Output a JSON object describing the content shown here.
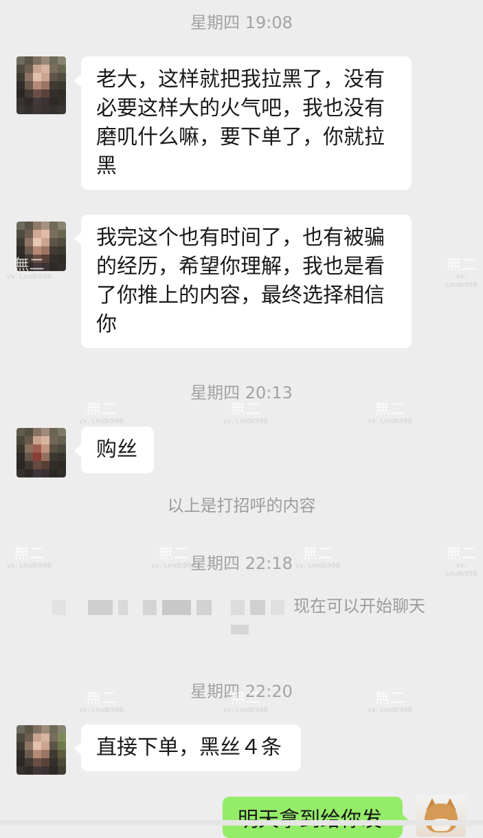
{
  "timestamps": [
    "星期四 19:08",
    "星期四 20:13",
    "星期四 22:18",
    "星期四 22:20"
  ],
  "messages": [
    {
      "lines": [
        "老大，这样就把我拉黑了，没有",
        "必要这样大的火气吧，我也没有",
        "磨叽什么嘛，要下单了，你就拉",
        "黑"
      ]
    },
    {
      "lines": [
        "我完这个也有时间了，也有被骗",
        "的经历，希望你理解，我也是看",
        "了你推上的内容，最终选择相信",
        "你"
      ]
    },
    {
      "lines": [
        "购丝"
      ]
    },
    {
      "lines": [
        "直接下单，黑丝４条"
      ]
    },
    {
      "lines": [
        "明天拿到给你发"
      ]
    }
  ],
  "system": {
    "greeting_note": "以上是打招呼的内容",
    "chat_start": "现在可以开始聊天"
  },
  "watermark": {
    "main": "無二",
    "sub": "vx: Lmdk998"
  },
  "colors": {
    "background": "#ededed",
    "bubble_incoming": "#ffffff",
    "bubble_outgoing": "#95ec69",
    "timestamp_text": "#a3a3a3"
  }
}
